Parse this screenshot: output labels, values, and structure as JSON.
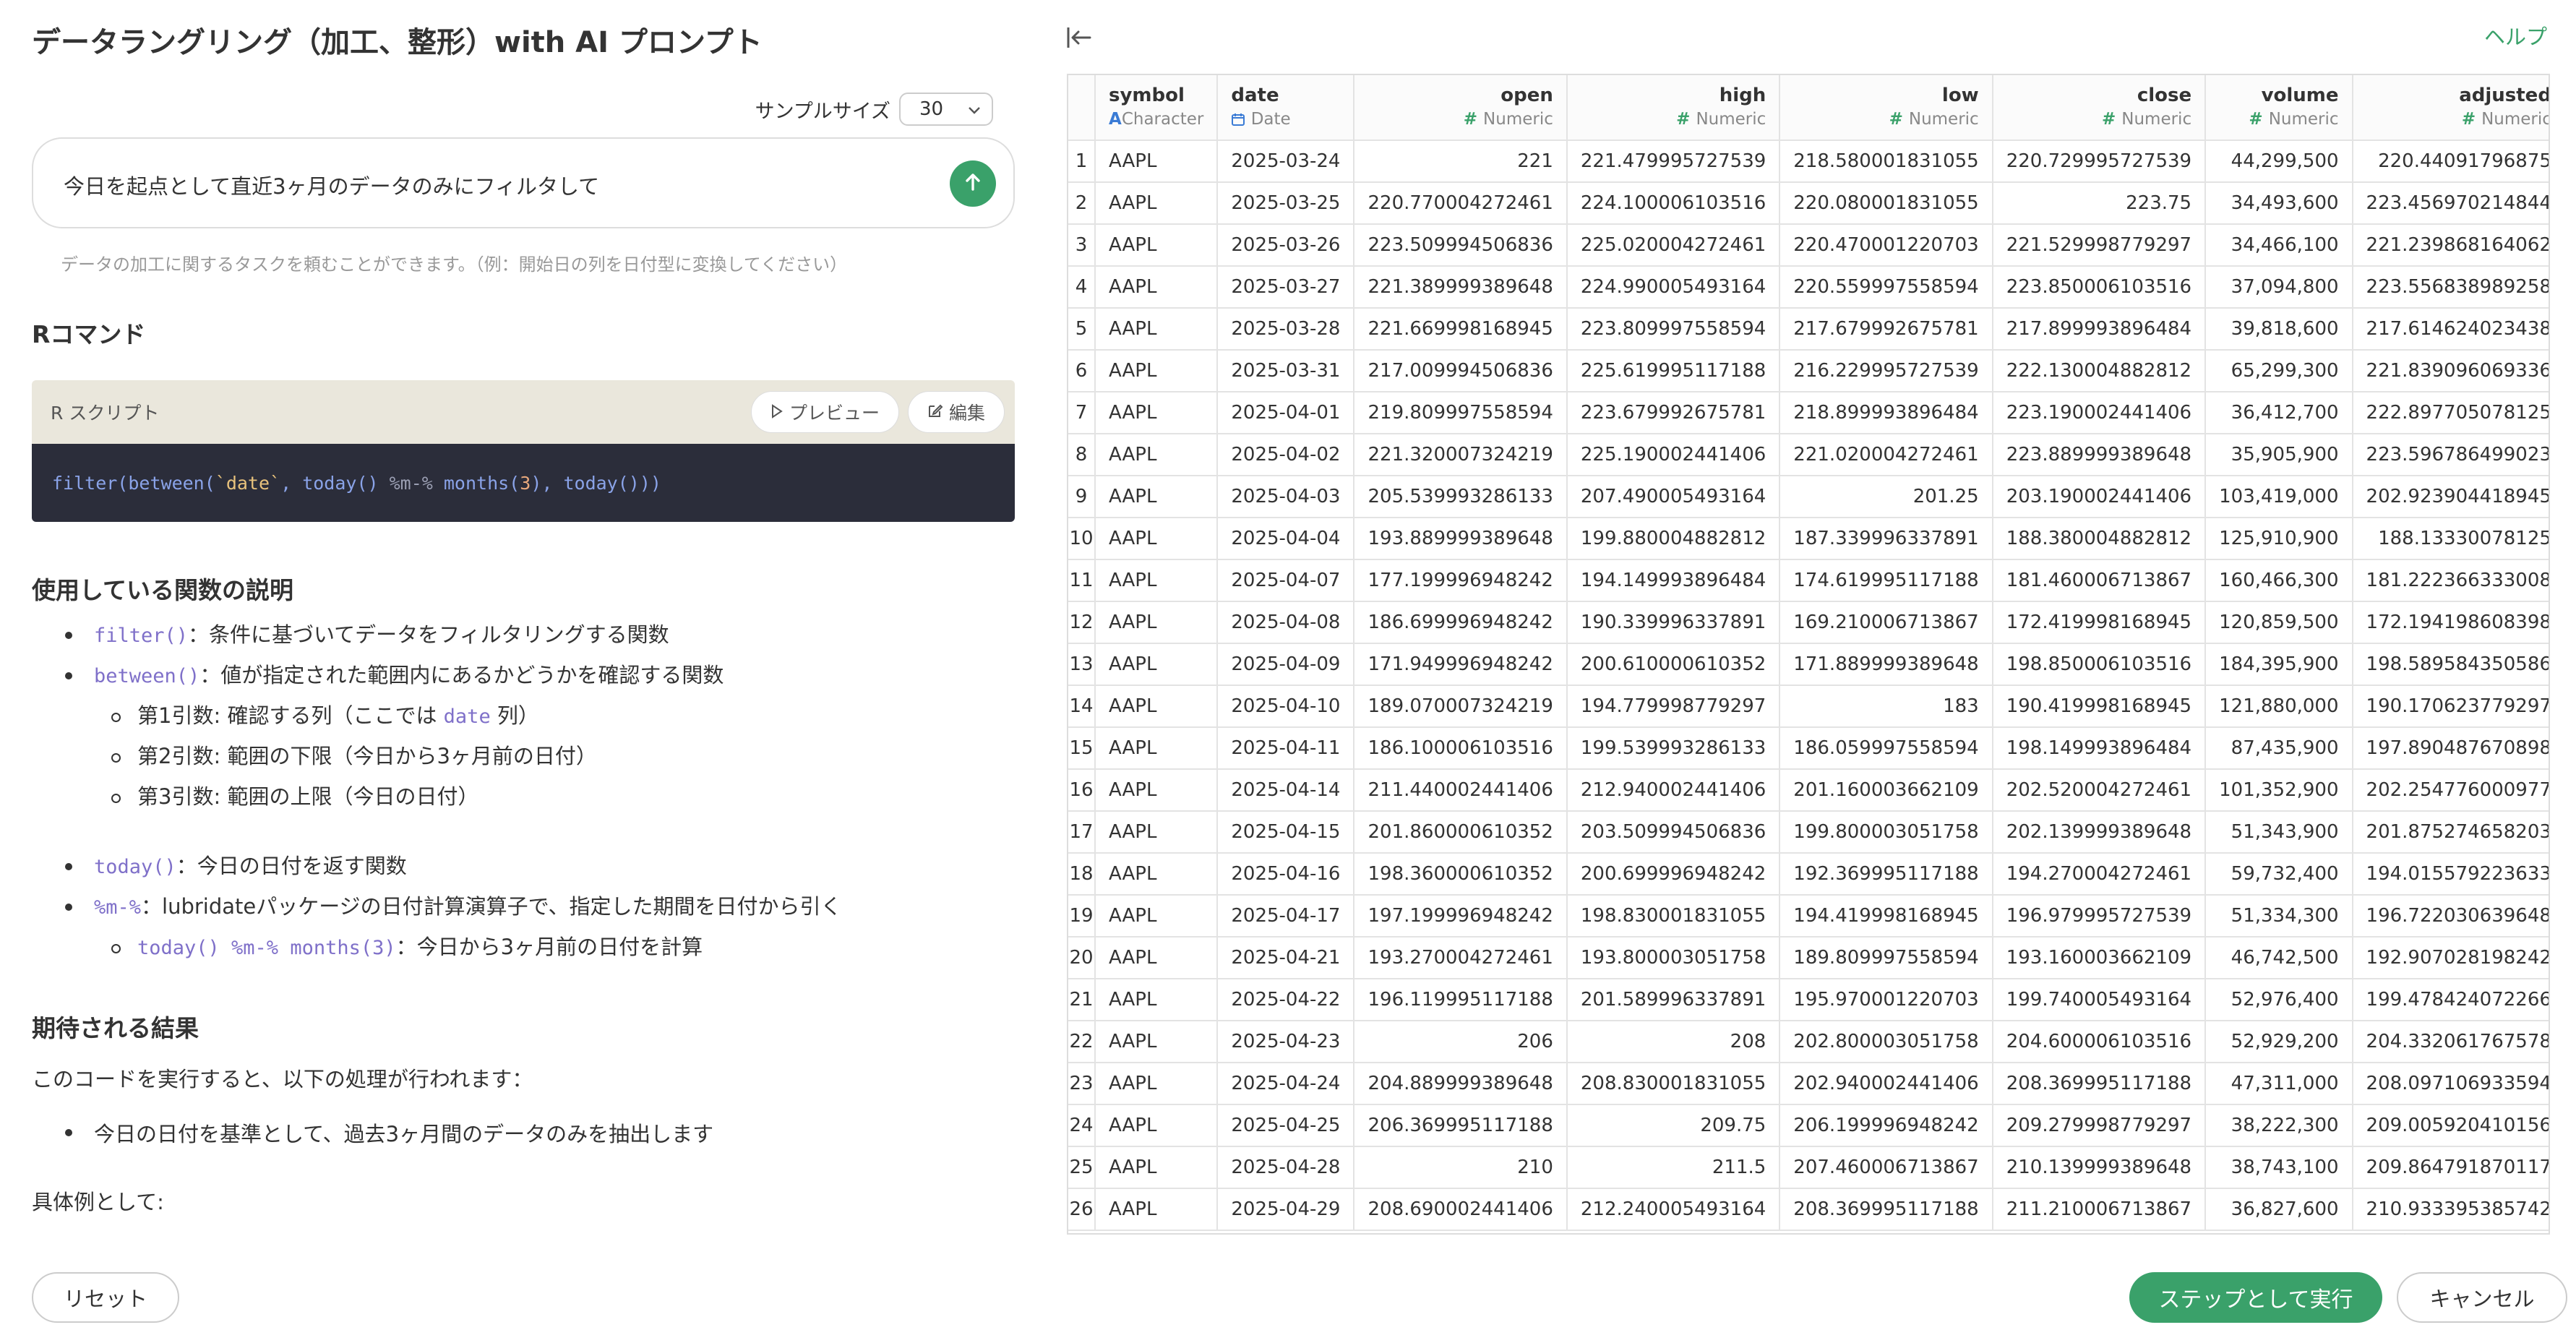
{
  "left": {
    "title": "データラングリング（加工、整形）with AI プロンプト",
    "sample_size_label": "サンプルサイズ",
    "sample_size_value": "30",
    "prompt_text": "今日を起点として直近3ヶ月のデータのみにフィルタして",
    "hint": "データの加工に関するタスクを頼むことができます。（例：開始日の列を日付型に変換してください）",
    "r_command_heading": "Rコマンド",
    "r_script_label": "R スクリプト",
    "preview_label": "プレビュー",
    "edit_label": "編集",
    "code_line": {
      "p1": "filter(between(",
      "p2": "`date`",
      "p3": ", today() ",
      "p4": "%m-%",
      "p5": " months(",
      "p6": "3",
      "p7": "), today()))"
    },
    "functions_heading": "使用している関数の説明",
    "functions": {
      "filter_code": "filter()",
      "filter_desc": "：条件に基づいてデータをフィルタリングする関数",
      "between_code": "between()",
      "between_desc": "：値が指定された範囲内にあるかどうかを確認する関数",
      "arg1_pre": "第1引数: 確認する列（ここでは ",
      "arg1_code": "date",
      "arg1_post": " 列）",
      "arg2": "第2引数: 範囲の下限（今日から3ヶ月前の日付）",
      "arg3": "第3引数: 範囲の上限（今日の日付）",
      "today_code": "today()",
      "today_desc": "：今日の日付を返す関数",
      "mminus_code": "%m-%",
      "mminus_desc": "：lubridateパッケージの日付計算演算子で、指定した期間を日付から引く",
      "sub_code": "today() %m-% months(3)",
      "sub_desc": "：今日から3ヶ月前の日付を計算"
    },
    "expected_heading": "期待される結果",
    "expected_text": "このコードを実行すると、以下の処理が行われます：",
    "expected_item": "今日の日付を基準として、過去3ヶ月間のデータのみを抽出します",
    "example_text": "具体例として:"
  },
  "right": {
    "help_label": "ヘルプ",
    "columns": [
      {
        "name": "symbol",
        "type": "Character",
        "icon": "A"
      },
      {
        "name": "date",
        "type": "Date",
        "icon": "calendar"
      },
      {
        "name": "open",
        "type": "Numeric",
        "icon": "#"
      },
      {
        "name": "high",
        "type": "Numeric",
        "icon": "#"
      },
      {
        "name": "low",
        "type": "Numeric",
        "icon": "#"
      },
      {
        "name": "close",
        "type": "Numeric",
        "icon": "#"
      },
      {
        "name": "volume",
        "type": "Numeric",
        "icon": "#"
      },
      {
        "name": "adjusted",
        "type": "Numeric",
        "icon": "#"
      }
    ],
    "rows": [
      [
        "1",
        "AAPL",
        "2025-03-24",
        "221",
        "221.479995727539",
        "218.580001831055",
        "220.729995727539",
        "44,299,500",
        "220.44091796875"
      ],
      [
        "2",
        "AAPL",
        "2025-03-25",
        "220.770004272461",
        "224.100006103516",
        "220.080001831055",
        "223.75",
        "34,493,600",
        "223.456970214844"
      ],
      [
        "3",
        "AAPL",
        "2025-03-26",
        "223.509994506836",
        "225.020004272461",
        "220.470001220703",
        "221.529998779297",
        "34,466,100",
        "221.239868164062"
      ],
      [
        "4",
        "AAPL",
        "2025-03-27",
        "221.389999389648",
        "224.990005493164",
        "220.559997558594",
        "223.850006103516",
        "37,094,800",
        "223.556838989258"
      ],
      [
        "5",
        "AAPL",
        "2025-03-28",
        "221.669998168945",
        "223.809997558594",
        "217.679992675781",
        "217.899993896484",
        "39,818,600",
        "217.614624023438"
      ],
      [
        "6",
        "AAPL",
        "2025-03-31",
        "217.009994506836",
        "225.619995117188",
        "216.229995727539",
        "222.130004882812",
        "65,299,300",
        "221.839096069336"
      ],
      [
        "7",
        "AAPL",
        "2025-04-01",
        "219.809997558594",
        "223.679992675781",
        "218.899993896484",
        "223.190002441406",
        "36,412,700",
        "222.897705078125"
      ],
      [
        "8",
        "AAPL",
        "2025-04-02",
        "221.320007324219",
        "225.190002441406",
        "221.020004272461",
        "223.889999389648",
        "35,905,900",
        "223.596786499023"
      ],
      [
        "9",
        "AAPL",
        "2025-04-03",
        "205.539993286133",
        "207.490005493164",
        "201.25",
        "203.190002441406",
        "103,419,000",
        "202.923904418945"
      ],
      [
        "10",
        "AAPL",
        "2025-04-04",
        "193.889999389648",
        "199.880004882812",
        "187.339996337891",
        "188.380004882812",
        "125,910,900",
        "188.13330078125"
      ],
      [
        "11",
        "AAPL",
        "2025-04-07",
        "177.199996948242",
        "194.149993896484",
        "174.619995117188",
        "181.460006713867",
        "160,466,300",
        "181.222366333008"
      ],
      [
        "12",
        "AAPL",
        "2025-04-08",
        "186.699996948242",
        "190.339996337891",
        "169.210006713867",
        "172.419998168945",
        "120,859,500",
        "172.194198608398"
      ],
      [
        "13",
        "AAPL",
        "2025-04-09",
        "171.949996948242",
        "200.610000610352",
        "171.889999389648",
        "198.850006103516",
        "184,395,900",
        "198.589584350586"
      ],
      [
        "14",
        "AAPL",
        "2025-04-10",
        "189.070007324219",
        "194.779998779297",
        "183",
        "190.419998168945",
        "121,880,000",
        "190.170623779297"
      ],
      [
        "15",
        "AAPL",
        "2025-04-11",
        "186.100006103516",
        "199.539993286133",
        "186.059997558594",
        "198.149993896484",
        "87,435,900",
        "197.890487670898"
      ],
      [
        "16",
        "AAPL",
        "2025-04-14",
        "211.440002441406",
        "212.940002441406",
        "201.160003662109",
        "202.520004272461",
        "101,352,900",
        "202.254776000977"
      ],
      [
        "17",
        "AAPL",
        "2025-04-15",
        "201.860000610352",
        "203.509994506836",
        "199.800003051758",
        "202.139999389648",
        "51,343,900",
        "201.875274658203"
      ],
      [
        "18",
        "AAPL",
        "2025-04-16",
        "198.360000610352",
        "200.699996948242",
        "192.369995117188",
        "194.270004272461",
        "59,732,400",
        "194.015579223633"
      ],
      [
        "19",
        "AAPL",
        "2025-04-17",
        "197.199996948242",
        "198.830001831055",
        "194.419998168945",
        "196.979995727539",
        "51,334,300",
        "196.722030639648"
      ],
      [
        "20",
        "AAPL",
        "2025-04-21",
        "193.270004272461",
        "193.800003051758",
        "189.809997558594",
        "193.160003662109",
        "46,742,500",
        "192.907028198242"
      ],
      [
        "21",
        "AAPL",
        "2025-04-22",
        "196.119995117188",
        "201.589996337891",
        "195.970001220703",
        "199.740005493164",
        "52,976,400",
        "199.478424072266"
      ],
      [
        "22",
        "AAPL",
        "2025-04-23",
        "206",
        "208",
        "202.800003051758",
        "204.600006103516",
        "52,929,200",
        "204.332061767578"
      ],
      [
        "23",
        "AAPL",
        "2025-04-24",
        "204.889999389648",
        "208.830001831055",
        "202.940002441406",
        "208.369995117188",
        "47,311,000",
        "208.097106933594"
      ],
      [
        "24",
        "AAPL",
        "2025-04-25",
        "206.369995117188",
        "209.75",
        "206.199996948242",
        "209.279998779297",
        "38,222,300",
        "209.005920410156"
      ],
      [
        "25",
        "AAPL",
        "2025-04-28",
        "210",
        "211.5",
        "207.460006713867",
        "210.139999389648",
        "38,743,100",
        "209.864791870117"
      ],
      [
        "26",
        "AAPL",
        "2025-04-29",
        "208.690002441406",
        "212.240005493164",
        "208.369995117188",
        "211.210006713867",
        "36,827,600",
        "210.933395385742"
      ]
    ]
  },
  "footer": {
    "reset_label": "リセット",
    "run_label": "ステップとして実行",
    "cancel_label": "キャンセル"
  },
  "colors": {
    "accent_green": "#3aa16a",
    "code_purple": "#7f70c9",
    "editor_bg": "#2b2d3a",
    "editor_header_bg": "#eae7dc"
  }
}
